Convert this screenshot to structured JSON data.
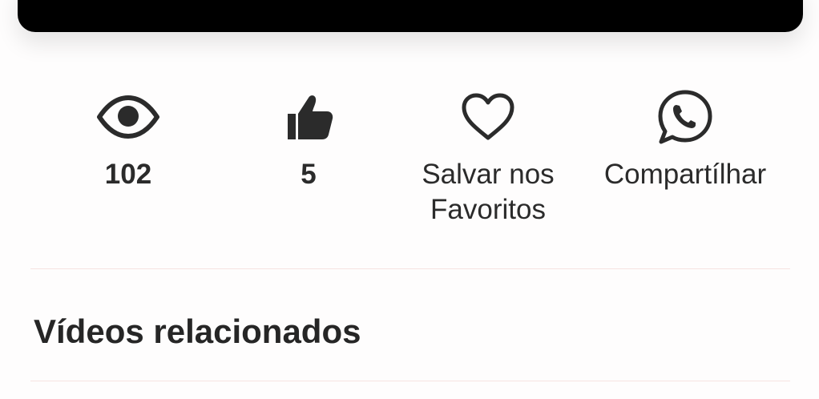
{
  "actions": {
    "views": {
      "icon": "eye-icon",
      "label": "102"
    },
    "likes": {
      "icon": "thumbs-up-icon",
      "label": "5"
    },
    "favorite": {
      "icon": "heart-icon",
      "label": "Salvar nos\nFavoritos"
    },
    "share": {
      "icon": "whatsapp-icon",
      "label": "Compartílhar"
    }
  },
  "related": {
    "title": "Vídeos relacionados"
  },
  "colors": {
    "text": "#2b2b2b",
    "player": "#000000",
    "divider": "#f6e3e1",
    "background": "#fefdfd"
  }
}
